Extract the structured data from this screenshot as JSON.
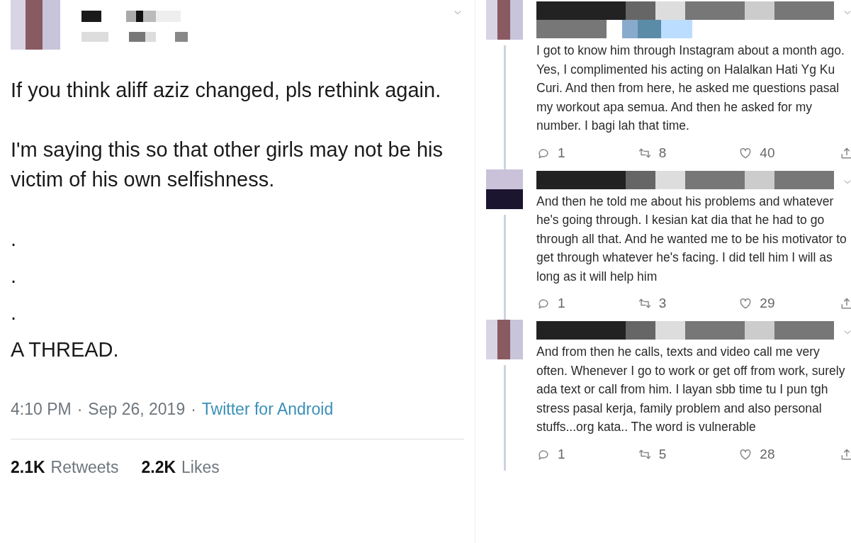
{
  "main_tweet": {
    "paragraphs": [
      "If you think aliff aziz changed, pls rethink again.",
      "I'm saying this so that other girls may not be his victim of his own selfishness.",
      ".",
      ".",
      ".",
      "A THREAD."
    ],
    "meta": [
      {
        "kind": "time",
        "text": "4:10 PM"
      },
      {
        "kind": "sep",
        "text": "·"
      },
      {
        "kind": "date",
        "text": "Sep 26, 2019"
      },
      {
        "kind": "sep",
        "text": "·"
      },
      {
        "kind": "link",
        "text": "Twitter for Android"
      }
    ],
    "stats": [
      {
        "count": "2.1K",
        "label": "Retweets"
      },
      {
        "count": "2.2K",
        "label": "Likes"
      }
    ]
  },
  "thread": [
    {
      "text": "I got to know him through Instagram about a month ago. Yes, I complimented his acting on Halalkan Hati Yg Ku Curi. And then from here, he asked me questions pasal my workout apa semua. And then he asked for my number. I bagi lah that time.",
      "replies": "1",
      "retweets": "8",
      "likes": "40"
    },
    {
      "text": "And then he told me about his problems and whatever he's going through. I kesian kat dia that he had to go through all that. And he wanted me to be his motivator to get through whatever he's facing. I did tell him I will as long as it will help him",
      "replies": "1",
      "retweets": "3",
      "likes": "29"
    },
    {
      "text": "And from then he calls, texts and video call me very often. Whenever I go to work or get off from work, surely ada text or call from him. I layan sbb time tu I pun tgh stress pasal kerja, family problem and also personal stuffs...org kata.. The word is vulnerable",
      "replies": "1",
      "retweets": "5",
      "likes": "28"
    }
  ]
}
